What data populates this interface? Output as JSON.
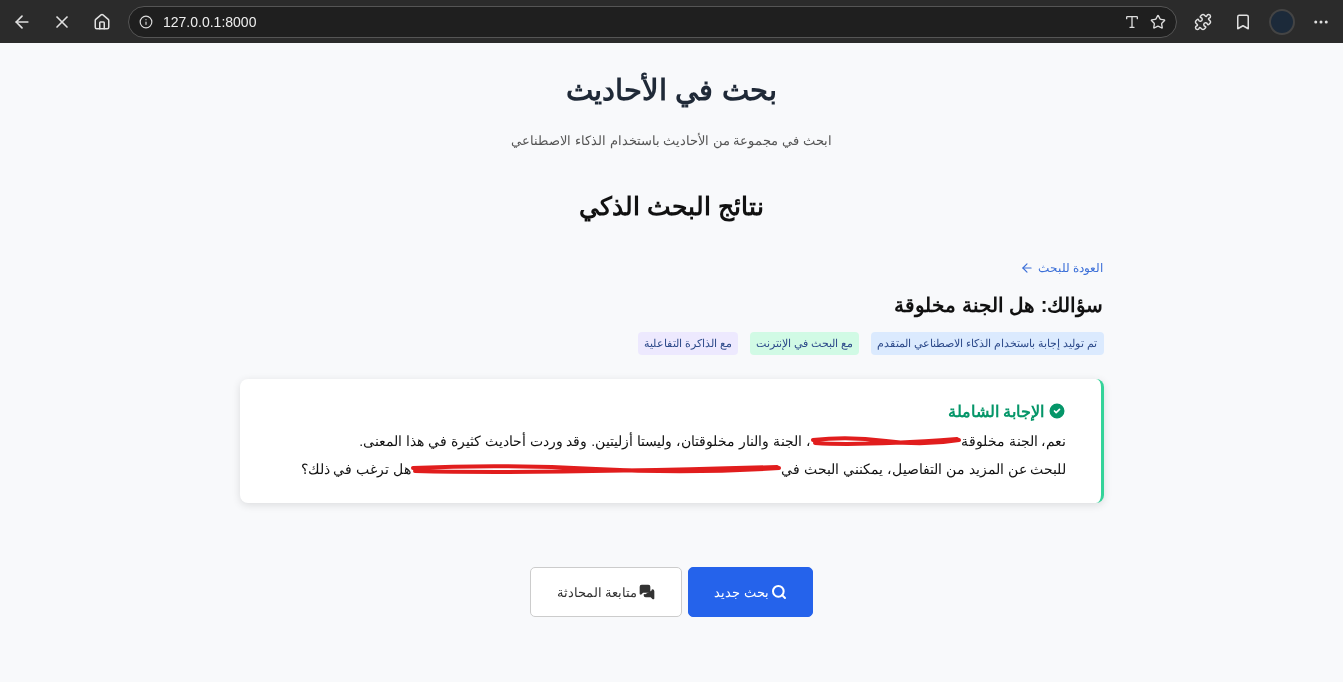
{
  "browser": {
    "url": "127.0.0.1:8000",
    "loading": true
  },
  "header": {
    "title": "بحث في الأحاديث",
    "subtitle": "ابحث في مجموعة من الأحاديث باستخدام الذكاء الاصطناعي"
  },
  "results_title": "نتائج البحث الذكي",
  "back_link": "العودة للبحث",
  "question": "سؤالك: هل الجنة مخلوقة",
  "badges": [
    {
      "label": "تم توليد إجابة باستخدام الذكاء الاصطناعي المتقدم",
      "color": "#dbeafe"
    },
    {
      "label": "مع البحث في الإنترنت",
      "color": "#d1fae5"
    },
    {
      "label": "مع الذاكرة التفاعلية",
      "color": "#ede9fe"
    }
  ],
  "answer": {
    "heading": "الإجابة الشاملة",
    "lines": [
      {
        "before": "نعم، الجنة مخلوقة",
        "after": "، الجنة والنار مخلوقتان، وليستا أزليتين. وقد وردت أحاديث كثيرة في هذا المعنى."
      },
      {
        "before": "للبحث عن المزيد من التفاصيل، يمكنني البحث في",
        "after": "هل ترغب في ذلك؟"
      }
    ]
  },
  "buttons": [
    {
      "label": "بحث جديد",
      "kind": "primary"
    },
    {
      "label": "متابعة المحادثة",
      "kind": "secondary"
    }
  ]
}
